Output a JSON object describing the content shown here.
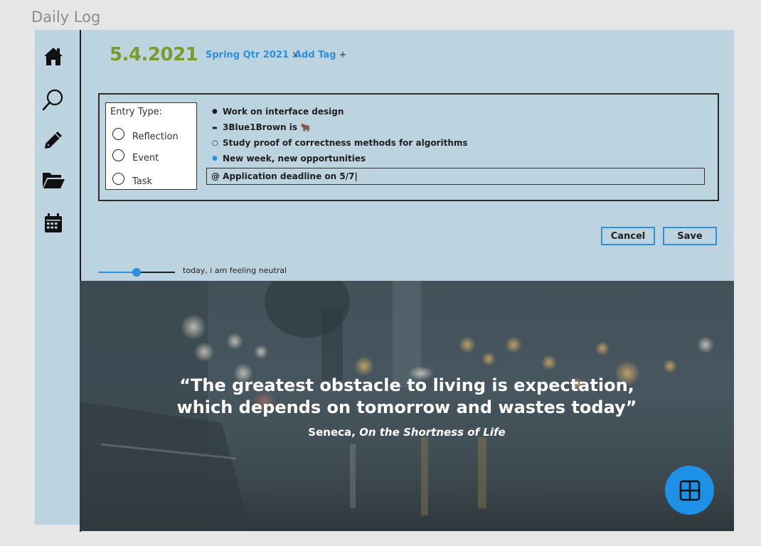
{
  "frame": {
    "title": "Daily Log"
  },
  "sidebar": {
    "items": [
      {
        "name": "home",
        "icon": "home-icon"
      },
      {
        "name": "search",
        "icon": "search-icon"
      },
      {
        "name": "edit",
        "icon": "pencil-icon"
      },
      {
        "name": "folder",
        "icon": "folder-open-icon"
      },
      {
        "name": "calendar",
        "icon": "calendar-icon"
      }
    ]
  },
  "header": {
    "date": "5.4.2021",
    "tags": [
      {
        "label": "Spring Qtr 2021",
        "symbol": "×"
      },
      {
        "label": "Add Tag",
        "symbol": "+"
      }
    ]
  },
  "entry_type": {
    "title": "Entry Type:",
    "options": [
      "Reflection",
      "Event",
      "Task"
    ]
  },
  "bullets": [
    {
      "marker": "●",
      "text": "Work on interface design"
    },
    {
      "marker": "▬",
      "text": "3Blue1Brown is 🐂"
    },
    {
      "marker": "○",
      "text": "Study proof of correctness methods for algorithms"
    },
    {
      "marker": "●",
      "text": "New week, new opportunities"
    }
  ],
  "current_entry": {
    "value": "@ Application deadline on 5/7|"
  },
  "actions": {
    "cancel_label": "Cancel",
    "save_label": "Save"
  },
  "mood": {
    "label": "today, i am feeling neutral",
    "value": 0.5
  },
  "quote": {
    "line1": "“The greatest obstacle to living is expectation,",
    "line2": "which depends on tomorrow and wastes today”",
    "author": "Seneca, ",
    "work": "On the Shortness of Life"
  },
  "colors": {
    "accent": "#2d8fe0",
    "date": "#7a9c2c",
    "panel": "#bcd4e0",
    "fab": "#1e90e6"
  },
  "fab": {
    "icon": "grid-icon"
  }
}
